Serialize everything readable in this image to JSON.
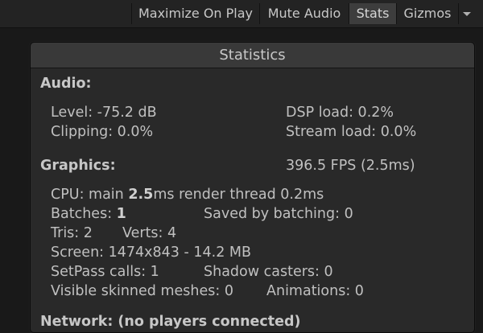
{
  "toolbar": {
    "maximize_label": "Maximize On Play",
    "mute_label": "Mute Audio",
    "stats_label": "Stats",
    "gizmos_label": "Gizmos",
    "dropdown_icon": "chevron-down-icon"
  },
  "stats": {
    "title": "Statistics",
    "audio": {
      "heading": "Audio:",
      "level": "Level: -75.2 dB",
      "clipping": "Clipping: 0.0%",
      "dsp_load": "DSP load: 0.2%",
      "stream_load": "Stream load: 0.0%"
    },
    "graphics": {
      "heading": "Graphics:",
      "fps": "396.5 FPS (2.5ms)",
      "cpu_prefix": "CPU: main ",
      "cpu_main": "2.5",
      "cpu_suffix": "ms  render thread 0.2ms",
      "batches_prefix": "Batches: ",
      "batches": "1",
      "saved_by_batching": "Saved by batching: 0",
      "tris": "Tris: 2",
      "verts": "Verts: 4",
      "screen": "Screen: 1474x843 - 14.2 MB",
      "setpass": "SetPass calls: 1",
      "shadow_casters": "Shadow casters: 0",
      "skinned_meshes": "Visible skinned meshes: 0",
      "animations": "Animations: 0"
    },
    "network": {
      "heading": "Network: (no players connected)"
    }
  }
}
